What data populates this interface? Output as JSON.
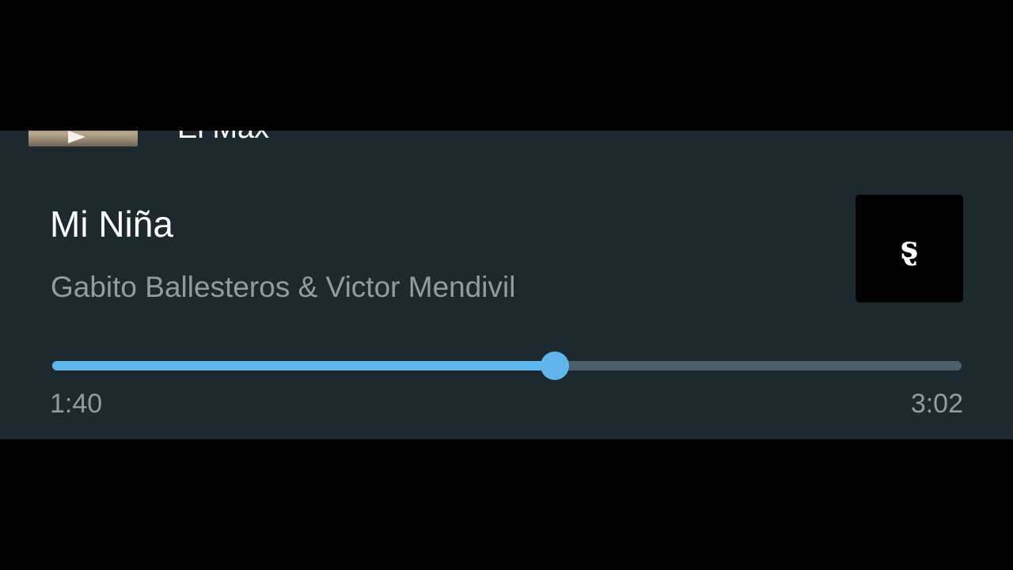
{
  "previous_item": {
    "title": "El Max"
  },
  "now_playing": {
    "title": "Mi Niña",
    "artist": "Gabito Ballesteros & Victor Mendivil",
    "cover_glyph": "ȿ",
    "elapsed": "1:40",
    "duration": "3:02",
    "progress": 0.553
  },
  "colors": {
    "panel_bg": "#1c2a30",
    "accent": "#5fb5ec",
    "track": "#4c5f6a",
    "secondary_text": "#8f9ca2"
  }
}
